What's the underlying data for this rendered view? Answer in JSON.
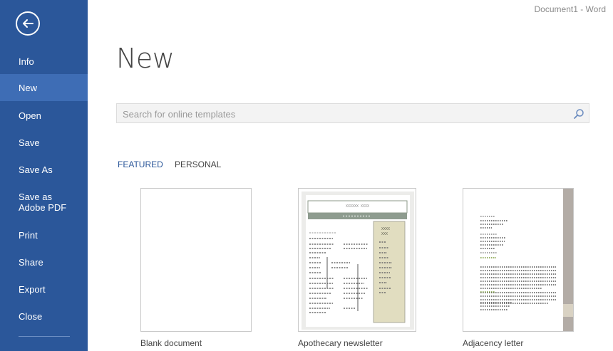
{
  "window": {
    "title": "Document1 - Word"
  },
  "sidebar": {
    "items": [
      {
        "label": "Info"
      },
      {
        "label": "New"
      },
      {
        "label": "Open"
      },
      {
        "label": "Save"
      },
      {
        "label": "Save As"
      },
      {
        "label": "Save as Adobe PDF"
      },
      {
        "label": "Print"
      },
      {
        "label": "Share"
      },
      {
        "label": "Export"
      },
      {
        "label": "Close"
      }
    ],
    "active": "New",
    "color": "#2b579a",
    "active_color": "#3e6db5"
  },
  "main": {
    "title": "New",
    "search": {
      "placeholder": "Search for online templates",
      "value": "",
      "icon": "search-icon"
    },
    "tabs": [
      {
        "label": "FEATURED",
        "selected": true
      },
      {
        "label": "PERSONAL",
        "selected": false
      }
    ],
    "templates": [
      {
        "label": "Blank document"
      },
      {
        "label": "Apothecary newsletter",
        "masthead_text": "XXXXXX XXXX",
        "sidebar_text_1": "XXXX",
        "sidebar_text_2": "XXX"
      },
      {
        "label": "Adjacency letter"
      }
    ]
  }
}
